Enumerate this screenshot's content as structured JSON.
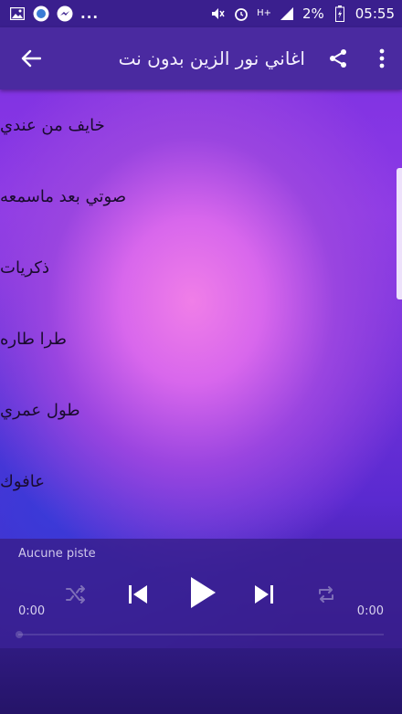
{
  "statusbar": {
    "left_icons": [
      "image-icon",
      "app-badge-icon",
      "messenger-icon"
    ],
    "more": "...",
    "network": "H+",
    "battery_percent": "2%",
    "time": "05:55"
  },
  "toolbar": {
    "title": "اغاني نور الزين بدون نت"
  },
  "songs": [
    {
      "label": "خايف من عندي"
    },
    {
      "label": "صوتي بعد ماسمعه"
    },
    {
      "label": "ذكريات"
    },
    {
      "label": "طرا طاره"
    },
    {
      "label": "طول عمري"
    },
    {
      "label": "عافوك"
    }
  ],
  "player": {
    "track": "Aucune piste",
    "time_elapsed": "0:00",
    "time_total": "0:00",
    "progress": 0
  },
  "colors": {
    "statusbar": "#3a1f8e",
    "toolbar": "#4a2aa0",
    "player": "#381e8c"
  }
}
